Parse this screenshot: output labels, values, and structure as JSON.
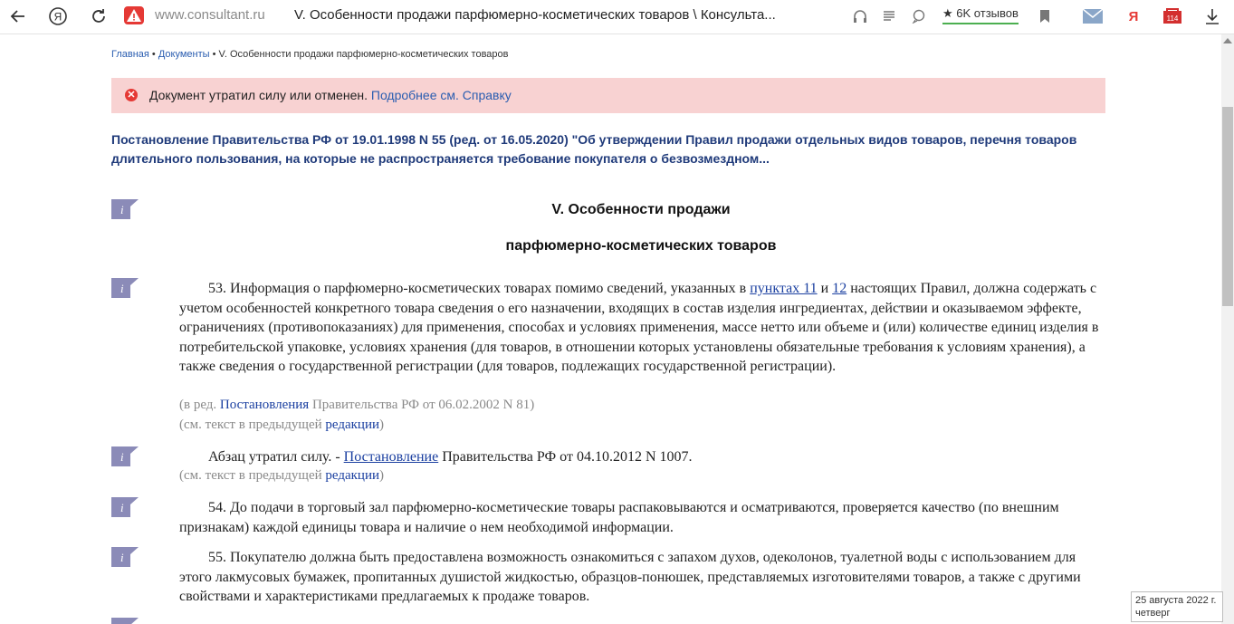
{
  "browser": {
    "domain": "www.consultant.ru",
    "title": "V. Особенности продажи парфюмерно-косметических товаров \\ Консульта...",
    "reviews_label": "6K отзывов",
    "yandex_mail_badge": "114"
  },
  "breadcrumb": {
    "home": "Главная",
    "sep1": " • ",
    "documents": "Документы",
    "sep2": " • ",
    "current": "V. Особенности продажи парфюмерно-косметических товаров"
  },
  "alert": {
    "icon": "✕",
    "text": "Документ утратил силу или отменен.",
    "link": "Подробнее см. Справку"
  },
  "doc_title": "Постановление Правительства РФ от 19.01.1998 N 55 (ред. от 16.05.2020) \"Об утверждении Правил продажи отдельных видов товаров, перечня товаров длительного пользования, на которые не распространяется требование покупателя о безвозмездном...",
  "section": {
    "line1": "V. Особенности продажи",
    "line2": "парфюмерно-косметических товаров"
  },
  "p53": {
    "t1": "53. Информация о парфюмерно-косметических товарах помимо сведений, указанных в ",
    "link1": "пунктах 11",
    "t2": " и ",
    "link2": "12",
    "t3": " настоящих Правил, должна содержать с учетом особенностей конкретного товара сведения о его назначении, входящих в состав изделия ингредиентах, действии и оказываемом эффекте, ограничениях (противопоказаниях) для применения, способах и условиях применения, массе нетто или объеме и (или) количестве единиц изделия в потребительской упаковке, условиях хранения (для товаров, в отношении которых установлены обязательные требования к условиям хранения), а также сведения о государственной регистрации (для товаров, подлежащих государственной регистрации).",
    "note1_pre": "(в ред. ",
    "note1_link": "Постановления",
    "note1_post": " Правительства РФ от 06.02.2002 N 81)",
    "note2_pre": "(см. текст в предыдущей ",
    "note2_link": "редакции",
    "note2_post": ")"
  },
  "p_abz": {
    "t1": "Абзац утратил силу. - ",
    "link": "Постановление",
    "t2": " Правительства РФ от 04.10.2012 N 1007.",
    "note_pre": "(см. текст в предыдущей ",
    "note_link": "редакции",
    "note_post": ")"
  },
  "p54": "54. До подачи в торговый зал парфюмерно-косметические товары распаковываются и осматриваются, проверяется качество (по внешним признакам) каждой единицы товара и наличие о нем необходимой информации.",
  "p55": "55. Покупателю должна быть предоставлена возможность ознакомиться с запахом духов, одеколонов, туалетной воды с использованием для этого лакмусовых бумажек, пропитанных душистой жидкостью, образцов-понюшек, представляемых изготовителями товаров, а также с другими свойствами и характеристиками предлагаемых к продаже товаров.",
  "date_widget": {
    "date": "25 августа 2022 г.",
    "weekday": "четверг"
  },
  "colors": {
    "alert_bg": "#f8d2d2",
    "alert_icon": "#e53935",
    "title": "#1f3a7a",
    "link": "#1a3fa0",
    "info_icon": "#8b8bb8"
  }
}
